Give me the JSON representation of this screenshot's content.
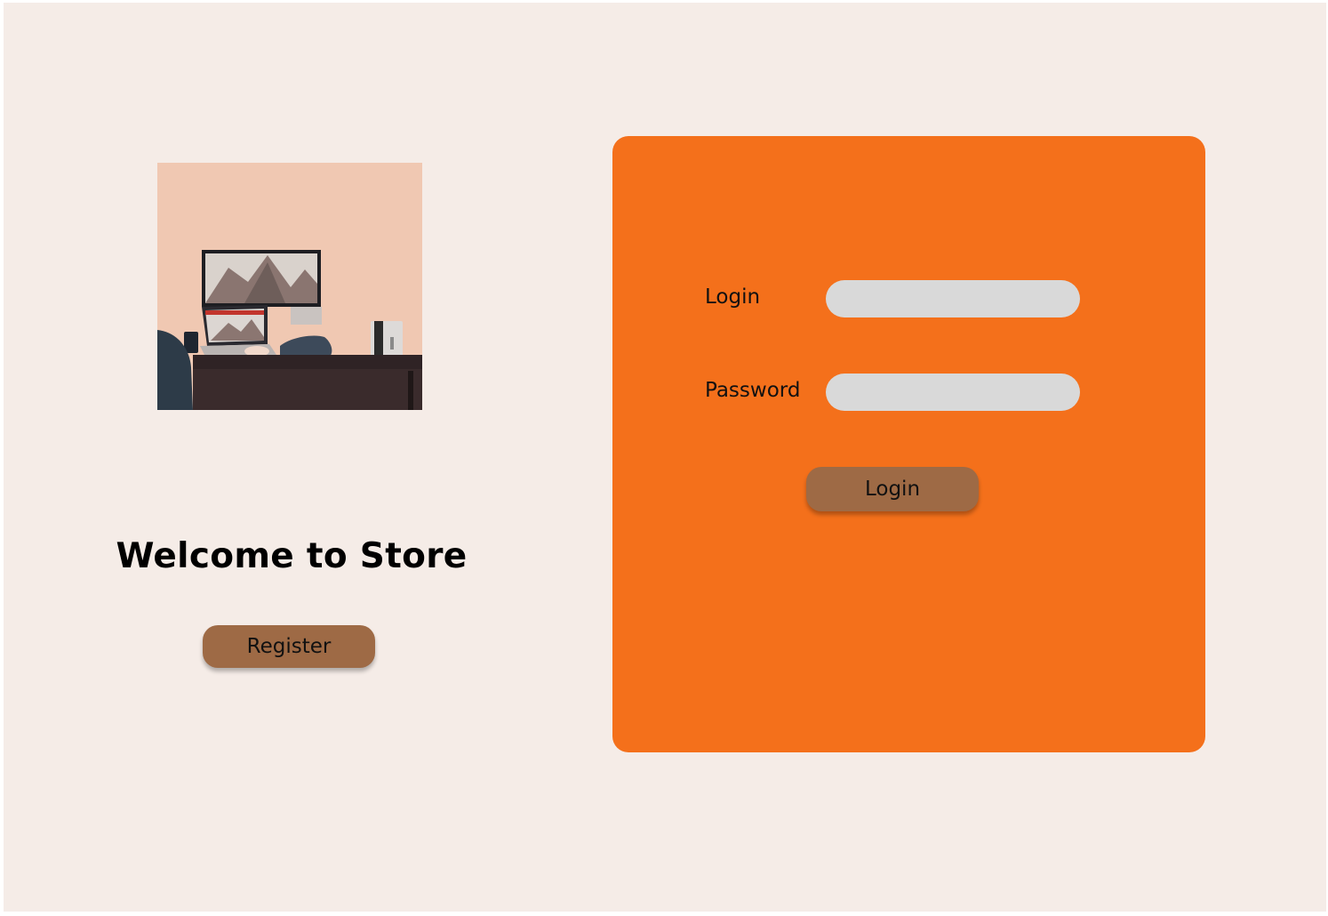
{
  "welcome": {
    "title": "Welcome to Store",
    "register_label": "Register"
  },
  "login_form": {
    "login_label": "Login",
    "login_value": "",
    "password_label": "Password",
    "password_value": "",
    "submit_label": "Login"
  },
  "colors": {
    "page_background": "#f5ece7",
    "panel": "#f4701b",
    "button": "#9e6a45",
    "input": "#d9d9d9"
  },
  "image": {
    "subject": "desk-workspace-illustration"
  }
}
